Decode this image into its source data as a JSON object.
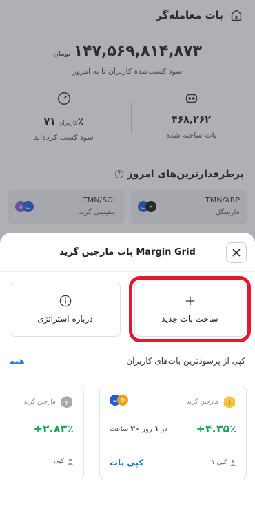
{
  "page": {
    "title": "بات معامله‌گر"
  },
  "hero": {
    "amount": "۱۴۷,۵۶۹,۸۱۴,۸۷۳",
    "unit": "تومان",
    "subtitle": "سود کسب‌شده کاربران تا به امروز"
  },
  "stats": [
    {
      "value": "۷۱٪",
      "value_suffix": "کاربران",
      "label": "سود کسب کرده‌اند",
      "icon": "gauge-icon"
    },
    {
      "value": "۴۶۸,۲۶۲",
      "value_suffix": "",
      "label": "بات ساخته شده",
      "icon": "robot-icon"
    }
  ],
  "popular": {
    "title": "پرطرفدارترین‌های امروز",
    "cards": [
      {
        "pair": "TMN/SOL",
        "strategy": "اینفینیتی گرید",
        "coin_color": "#8a55e6"
      },
      {
        "pair": "TMN/XRP",
        "strategy": "مارتینگل",
        "coin_color": "#1b1b1b"
      }
    ]
  },
  "sheet": {
    "title": "بات مارجین گرید Margin Grid",
    "actions": {
      "about": "درباره استراتژی",
      "create": "ساخت بات جدید"
    },
    "copy_section": {
      "title": "کپی از پرسودترین بات‌های کاربران",
      "all": "همه"
    },
    "bots": [
      {
        "type": "مارجین گرید",
        "profit": "+۴.۳۵٪",
        "duration_prefix": "در",
        "days": "۱",
        "days_unit": "روز",
        "hours": "۲۰",
        "hours_unit": "ساعت",
        "copies": "۱ کپی",
        "copy_button": "کپی بات",
        "badge_color": "#f4c542",
        "badge_text": "!"
      },
      {
        "type": "مارجین گرید",
        "profit": "+۲.۸۳٪",
        "copies": "۰ کپی",
        "badge_color": "#a6abb2",
        "badge_text": "۲"
      }
    ]
  },
  "colors": {
    "accent": "#1677d2",
    "profit": "#1ca35a",
    "highlight": "#e3182e"
  }
}
